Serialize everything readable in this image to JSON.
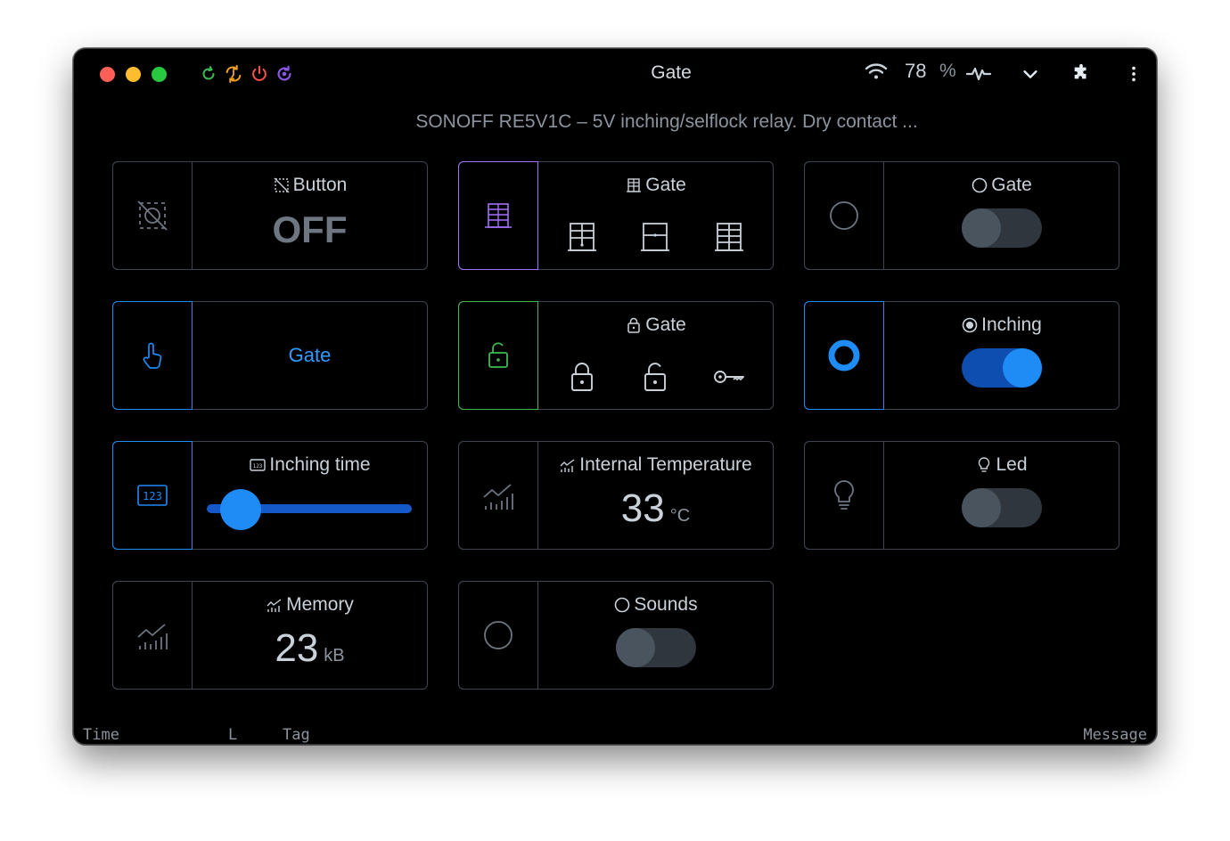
{
  "window": {
    "title": "Gate",
    "subtitle": "SONOFF RE5V1C – 5V inching/selflock relay. Dry contact ...",
    "battery_value": "78",
    "battery_unit": "%"
  },
  "toolbar_icons": [
    "refresh-icon",
    "sync-icon",
    "power-icon",
    "restart-icon"
  ],
  "status_icons": [
    "wifi-icon",
    "activity-icon",
    "chevron-down-icon",
    "puzzle-icon",
    "more-vertical-icon"
  ],
  "colors": {
    "accent_blue": "#1f8bf5",
    "accent_purple": "#a371f7",
    "accent_green": "#3fb950",
    "toolbar_green": "#3fb950",
    "toolbar_orange": "#f0a020",
    "toolbar_red": "#f85149",
    "toolbar_purple": "#8957e5"
  },
  "cards": {
    "button": {
      "label": "Button",
      "value": "OFF"
    },
    "gate_cover": {
      "label": "Gate"
    },
    "gate_switch": {
      "label": "Gate",
      "on": false
    },
    "gate_action": {
      "label": "Gate"
    },
    "gate_lock": {
      "label": "Gate"
    },
    "inching": {
      "label": "Inching",
      "on": true
    },
    "inching_time": {
      "label": "Inching time",
      "slider_fraction": 0.12
    },
    "internal_temperature": {
      "label": "Internal Temperature",
      "value": "33",
      "unit": "°C"
    },
    "led": {
      "label": "Led",
      "on": false
    },
    "memory": {
      "label": "Memory",
      "value": "23",
      "unit": "kB"
    },
    "sounds": {
      "label": "Sounds",
      "on": false
    }
  },
  "footer": {
    "time": "Time",
    "level": "L",
    "tag": "Tag",
    "message": "Message"
  }
}
